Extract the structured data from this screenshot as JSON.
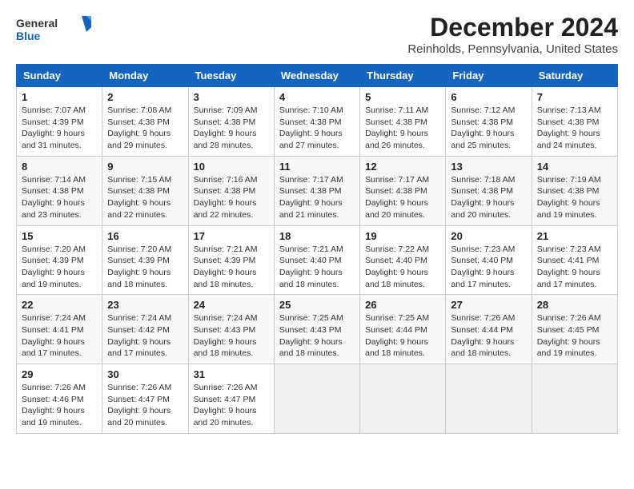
{
  "logo": {
    "general": "General",
    "blue": "Blue"
  },
  "title": "December 2024",
  "subtitle": "Reinholds, Pennsylvania, United States",
  "calendar": {
    "headers": [
      "Sunday",
      "Monday",
      "Tuesday",
      "Wednesday",
      "Thursday",
      "Friday",
      "Saturday"
    ],
    "weeks": [
      [
        {
          "day": "1",
          "info": "Sunrise: 7:07 AM\nSunset: 4:39 PM\nDaylight: 9 hours and 31 minutes."
        },
        {
          "day": "2",
          "info": "Sunrise: 7:08 AM\nSunset: 4:38 PM\nDaylight: 9 hours and 29 minutes."
        },
        {
          "day": "3",
          "info": "Sunrise: 7:09 AM\nSunset: 4:38 PM\nDaylight: 9 hours and 28 minutes."
        },
        {
          "day": "4",
          "info": "Sunrise: 7:10 AM\nSunset: 4:38 PM\nDaylight: 9 hours and 27 minutes."
        },
        {
          "day": "5",
          "info": "Sunrise: 7:11 AM\nSunset: 4:38 PM\nDaylight: 9 hours and 26 minutes."
        },
        {
          "day": "6",
          "info": "Sunrise: 7:12 AM\nSunset: 4:38 PM\nDaylight: 9 hours and 25 minutes."
        },
        {
          "day": "7",
          "info": "Sunrise: 7:13 AM\nSunset: 4:38 PM\nDaylight: 9 hours and 24 minutes."
        }
      ],
      [
        {
          "day": "8",
          "info": "Sunrise: 7:14 AM\nSunset: 4:38 PM\nDaylight: 9 hours and 23 minutes."
        },
        {
          "day": "9",
          "info": "Sunrise: 7:15 AM\nSunset: 4:38 PM\nDaylight: 9 hours and 22 minutes."
        },
        {
          "day": "10",
          "info": "Sunrise: 7:16 AM\nSunset: 4:38 PM\nDaylight: 9 hours and 22 minutes."
        },
        {
          "day": "11",
          "info": "Sunrise: 7:17 AM\nSunset: 4:38 PM\nDaylight: 9 hours and 21 minutes."
        },
        {
          "day": "12",
          "info": "Sunrise: 7:17 AM\nSunset: 4:38 PM\nDaylight: 9 hours and 20 minutes."
        },
        {
          "day": "13",
          "info": "Sunrise: 7:18 AM\nSunset: 4:38 PM\nDaylight: 9 hours and 20 minutes."
        },
        {
          "day": "14",
          "info": "Sunrise: 7:19 AM\nSunset: 4:38 PM\nDaylight: 9 hours and 19 minutes."
        }
      ],
      [
        {
          "day": "15",
          "info": "Sunrise: 7:20 AM\nSunset: 4:39 PM\nDaylight: 9 hours and 19 minutes."
        },
        {
          "day": "16",
          "info": "Sunrise: 7:20 AM\nSunset: 4:39 PM\nDaylight: 9 hours and 18 minutes."
        },
        {
          "day": "17",
          "info": "Sunrise: 7:21 AM\nSunset: 4:39 PM\nDaylight: 9 hours and 18 minutes."
        },
        {
          "day": "18",
          "info": "Sunrise: 7:21 AM\nSunset: 4:40 PM\nDaylight: 9 hours and 18 minutes."
        },
        {
          "day": "19",
          "info": "Sunrise: 7:22 AM\nSunset: 4:40 PM\nDaylight: 9 hours and 18 minutes."
        },
        {
          "day": "20",
          "info": "Sunrise: 7:23 AM\nSunset: 4:40 PM\nDaylight: 9 hours and 17 minutes."
        },
        {
          "day": "21",
          "info": "Sunrise: 7:23 AM\nSunset: 4:41 PM\nDaylight: 9 hours and 17 minutes."
        }
      ],
      [
        {
          "day": "22",
          "info": "Sunrise: 7:24 AM\nSunset: 4:41 PM\nDaylight: 9 hours and 17 minutes."
        },
        {
          "day": "23",
          "info": "Sunrise: 7:24 AM\nSunset: 4:42 PM\nDaylight: 9 hours and 17 minutes."
        },
        {
          "day": "24",
          "info": "Sunrise: 7:24 AM\nSunset: 4:43 PM\nDaylight: 9 hours and 18 minutes."
        },
        {
          "day": "25",
          "info": "Sunrise: 7:25 AM\nSunset: 4:43 PM\nDaylight: 9 hours and 18 minutes."
        },
        {
          "day": "26",
          "info": "Sunrise: 7:25 AM\nSunset: 4:44 PM\nDaylight: 9 hours and 18 minutes."
        },
        {
          "day": "27",
          "info": "Sunrise: 7:26 AM\nSunset: 4:44 PM\nDaylight: 9 hours and 18 minutes."
        },
        {
          "day": "28",
          "info": "Sunrise: 7:26 AM\nSunset: 4:45 PM\nDaylight: 9 hours and 19 minutes."
        }
      ],
      [
        {
          "day": "29",
          "info": "Sunrise: 7:26 AM\nSunset: 4:46 PM\nDaylight: 9 hours and 19 minutes."
        },
        {
          "day": "30",
          "info": "Sunrise: 7:26 AM\nSunset: 4:47 PM\nDaylight: 9 hours and 20 minutes."
        },
        {
          "day": "31",
          "info": "Sunrise: 7:26 AM\nSunset: 4:47 PM\nDaylight: 9 hours and 20 minutes."
        },
        null,
        null,
        null,
        null
      ]
    ]
  }
}
